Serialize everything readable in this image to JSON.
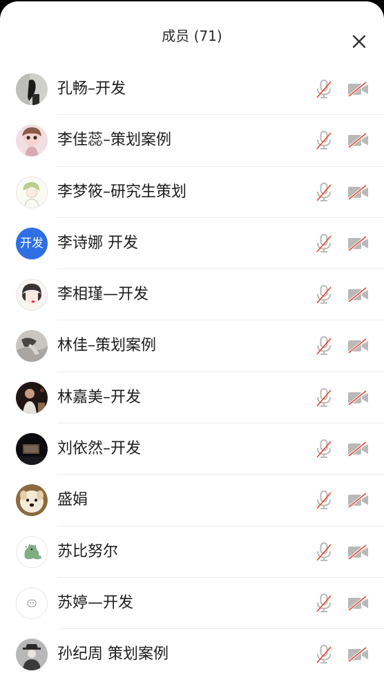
{
  "header": {
    "title": "成员 (71)"
  },
  "icons": {
    "close": "close-icon",
    "mic": "mic-off-icon",
    "camera": "camera-off-icon"
  },
  "colors": {
    "muted_slash": "#e8442a",
    "icon_gray": "#b9b9b9",
    "avatar_blue": "#2f6fe4"
  },
  "members": [
    {
      "name": "孔畅–开发",
      "avatar": "photo"
    },
    {
      "name": "李佳蕊–策划案例",
      "avatar": "photo"
    },
    {
      "name": "李梦筱–研究生策划",
      "avatar": "photo"
    },
    {
      "name": "李诗娜 开发",
      "avatar": "text",
      "avatar_text": "开发"
    },
    {
      "name": "李相瑾—开发",
      "avatar": "photo"
    },
    {
      "name": "林佳–策划案例",
      "avatar": "photo"
    },
    {
      "name": "林嘉美–开发",
      "avatar": "photo"
    },
    {
      "name": "刘依然–开发",
      "avatar": "photo"
    },
    {
      "name": "盛娟",
      "avatar": "photo"
    },
    {
      "name": "苏比努尔",
      "avatar": "photo"
    },
    {
      "name": "苏婷—开发",
      "avatar": "photo"
    },
    {
      "name": "孙纪周 策划案例",
      "avatar": "photo"
    }
  ]
}
